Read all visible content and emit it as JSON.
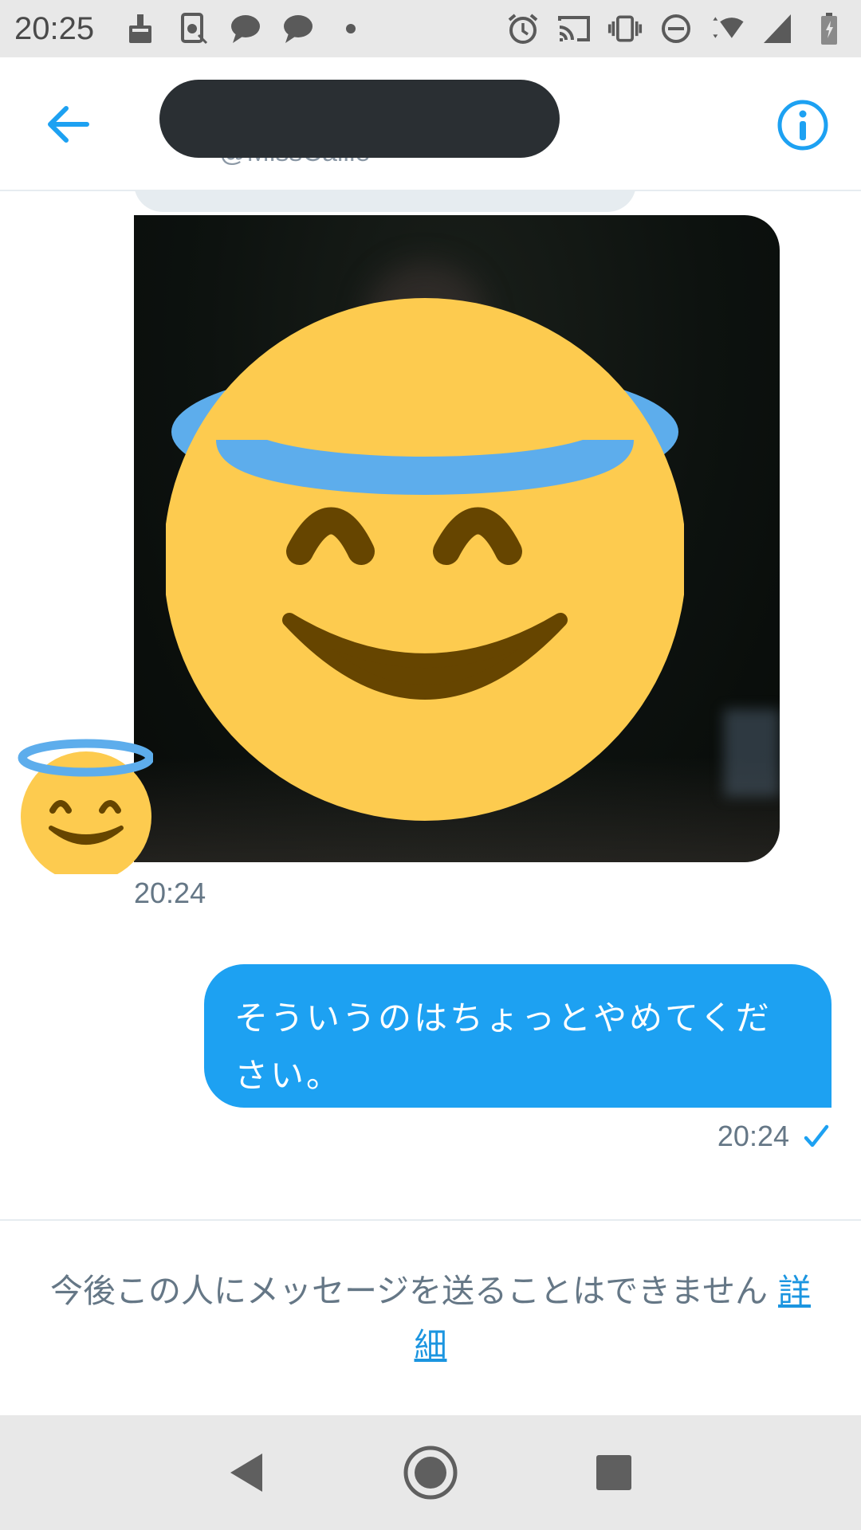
{
  "status_bar": {
    "time": "20:25",
    "left_icons": [
      "cleaner-icon",
      "screenshot-blocked-icon",
      "chat-bubble-icon",
      "chat-bubble-icon",
      "dot-icon"
    ],
    "right_icons": [
      "alarm-icon",
      "cast-icon",
      "vibrate-icon",
      "do-not-disturb-icon",
      "wifi-icon",
      "signal-icon",
      "battery-icon"
    ]
  },
  "header": {
    "handle": "@MissCallie"
  },
  "messages": {
    "received": {
      "timestamp": "20:24",
      "media": "angel-emoji-over-dark-photo"
    },
    "sent": {
      "line1": "そういうのはちょっとやめてくだ",
      "line2": "さい。",
      "timestamp": "20:24",
      "status_icon": "checkmark-icon"
    }
  },
  "footer": {
    "notice": "今後この人にメッセージを送ることはできません ",
    "link": "詳細"
  },
  "colors": {
    "accent": "#1da1f2",
    "secondary_text": "#657786",
    "emoji_face": "#fdcb4f",
    "emoji_halo": "#5dadec",
    "emoji_features": "#664500"
  },
  "nav": [
    "back-icon",
    "home-icon",
    "recents-icon"
  ]
}
